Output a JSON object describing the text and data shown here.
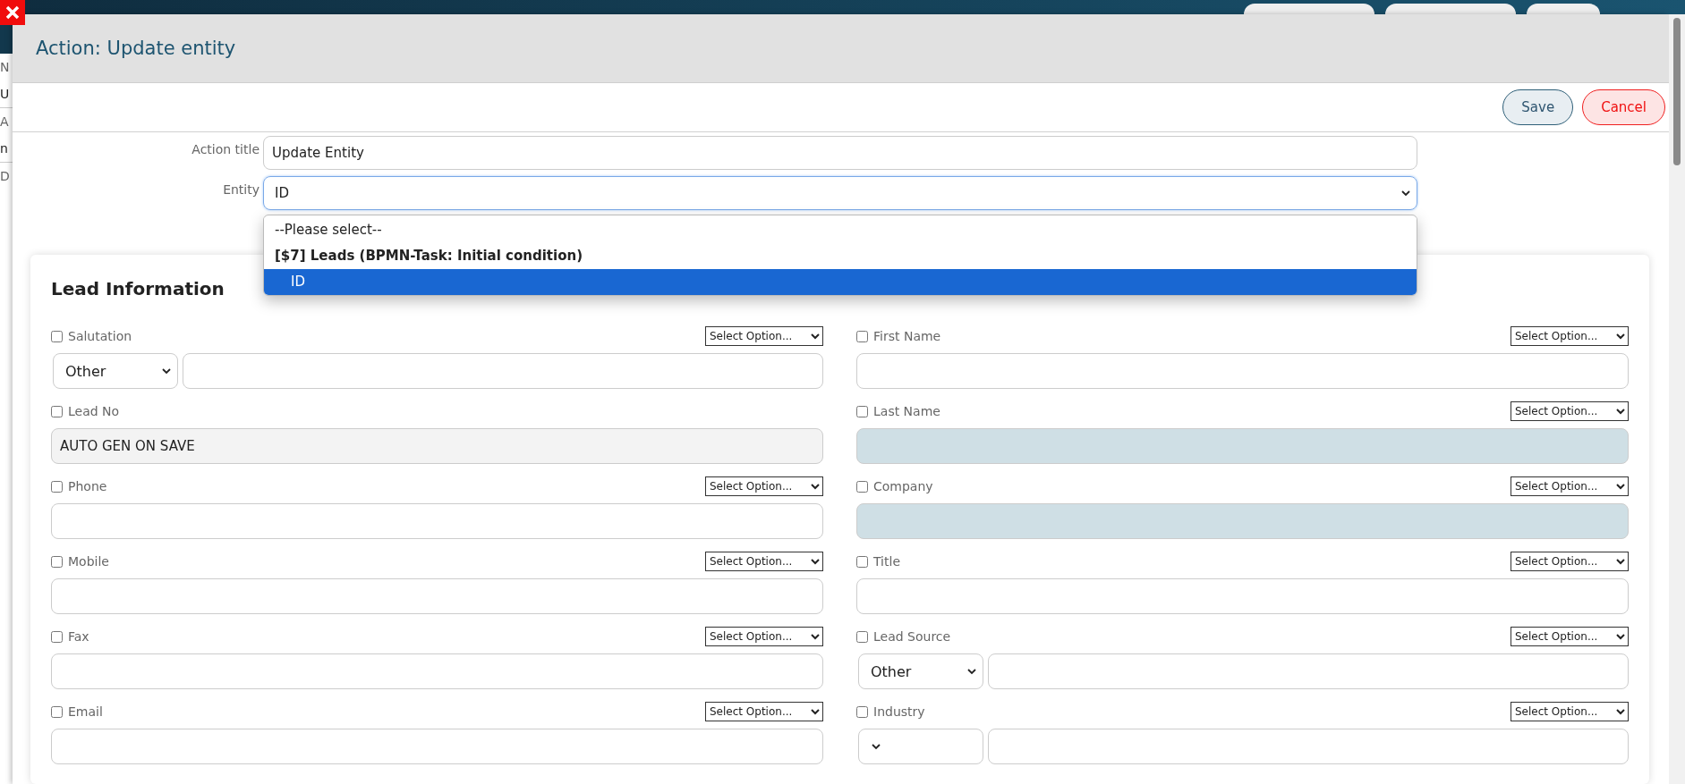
{
  "background": {
    "side_texts": [
      "N",
      "U",
      "A",
      "n",
      "D"
    ]
  },
  "dialog": {
    "title": "Action: Update entity",
    "buttons": [
      {
        "kind": "save",
        "label": "Save"
      },
      {
        "kind": "cancel",
        "label": "Cancel"
      }
    ]
  },
  "action_title": {
    "label": "Action title",
    "value": "Update Entity"
  },
  "entity": {
    "label": "Entity",
    "value": "ID",
    "expanded": true,
    "options": [
      {
        "kind": "placeholder",
        "label": "--Please select--",
        "selected": false
      },
      {
        "kind": "group",
        "label": "[$7] Leads (BPMN-Task: Initial condition)",
        "selected": false
      },
      {
        "kind": "option",
        "label": "ID",
        "selected": true
      }
    ]
  },
  "section": {
    "title": "Lead Information",
    "columns": [
      [
        {
          "kind": "combo",
          "label": "Salutation",
          "checked": false,
          "option": "Select Option...",
          "choice": "Other"
        },
        {
          "kind": "readonly",
          "label": "Lead No",
          "checked": false,
          "value": "AUTO GEN ON SAVE"
        },
        {
          "kind": "text",
          "label": "Phone",
          "checked": false,
          "option": "Select Option..."
        },
        {
          "kind": "text",
          "label": "Mobile",
          "checked": false,
          "option": "Select Option..."
        },
        {
          "kind": "text",
          "label": "Fax",
          "checked": false,
          "option": "Select Option..."
        },
        {
          "kind": "text",
          "label": "Email",
          "checked": false,
          "option": "Select Option..."
        }
      ],
      [
        {
          "kind": "text",
          "label": "First Name",
          "checked": false,
          "option": "Select Option..."
        },
        {
          "kind": "required",
          "label": "Last Name",
          "checked": false,
          "option": "Select Option..."
        },
        {
          "kind": "required",
          "label": "Company",
          "checked": false,
          "option": "Select Option..."
        },
        {
          "kind": "text",
          "label": "Title",
          "checked": false,
          "option": "Select Option..."
        },
        {
          "kind": "combo",
          "label": "Lead Source",
          "checked": false,
          "option": "Select Option...",
          "choice": "Other"
        },
        {
          "kind": "combo",
          "label": "Industry",
          "checked": false,
          "option": "Select Option..."
        }
      ]
    ]
  }
}
